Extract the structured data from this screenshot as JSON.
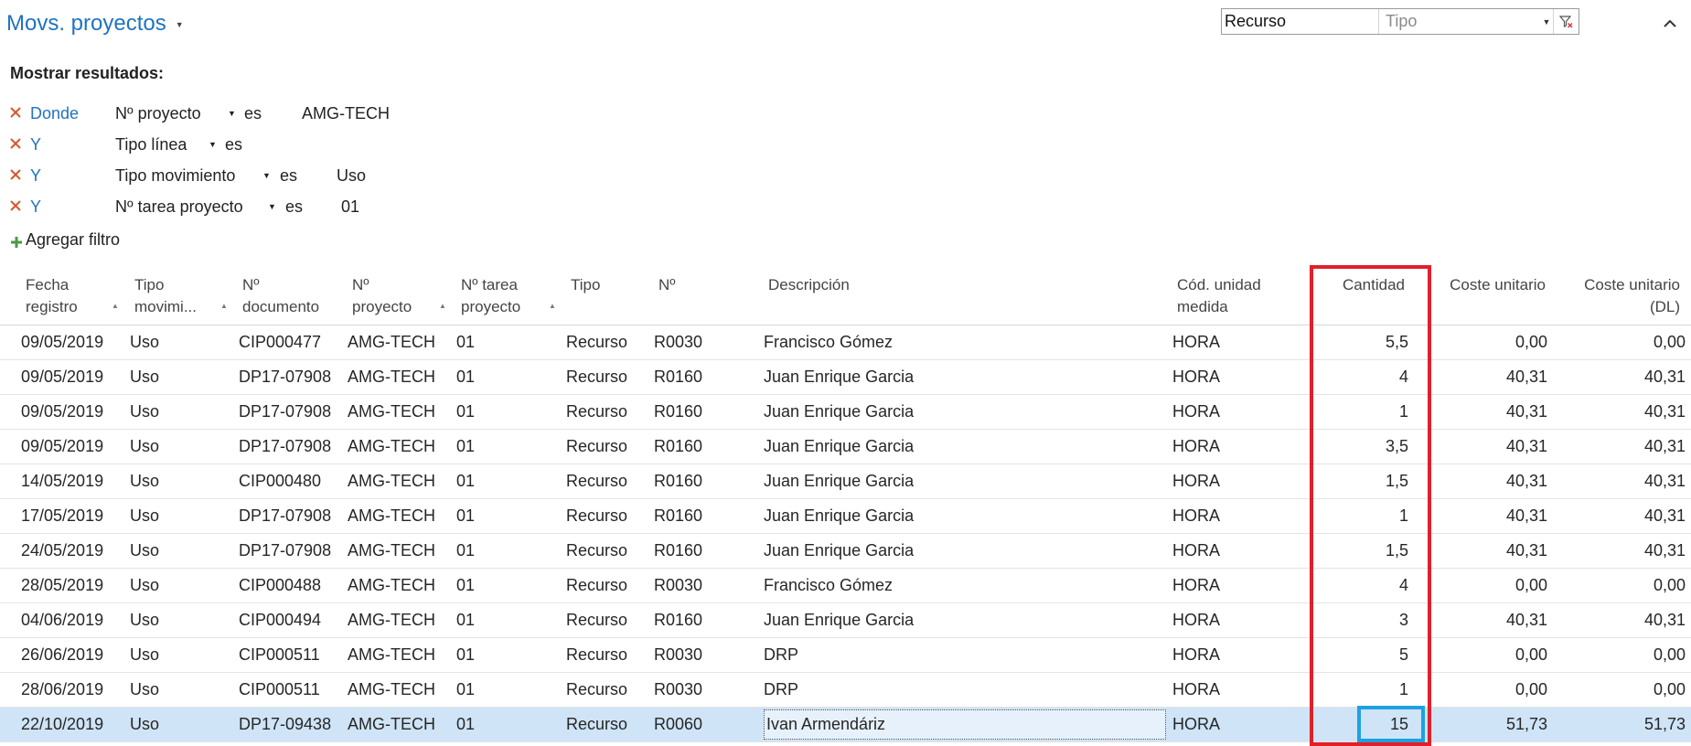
{
  "page": {
    "title": "Movs. proyectos"
  },
  "search": {
    "value": "Recurso",
    "type_placeholder": "Tipo"
  },
  "filters": {
    "label": "Mostrar resultados:",
    "rows": [
      {
        "conj": "Donde",
        "field": "Nº proyecto",
        "op": "es",
        "value": "AMG-TECH"
      },
      {
        "conj": "Y",
        "field": "Tipo línea",
        "op": "es",
        "value": ""
      },
      {
        "conj": "Y",
        "field": "Tipo movimiento",
        "op": "es",
        "value": "Uso"
      },
      {
        "conj": "Y",
        "field": "Nº tarea proyecto",
        "op": "es",
        "value": "01"
      }
    ],
    "add_label": "Agregar filtro"
  },
  "table": {
    "headers": {
      "fecha_1": "Fecha",
      "fecha_2": "registro",
      "tipo_mov_1": "Tipo",
      "tipo_mov_2": "movimi...",
      "ndoc_1": "Nº",
      "ndoc_2": "documento",
      "nproy_1": "Nº",
      "nproy_2": "proyecto",
      "ntarea_1": "Nº tarea",
      "ntarea_2": "proyecto",
      "tipo": "Tipo",
      "n": "Nº",
      "desc": "Descripción",
      "unidad_1": "Cód. unidad",
      "unidad_2": "medida",
      "cantidad": "Cantidad",
      "coste": "Coste unitario",
      "costedl_1": "Coste unitario",
      "costedl_2": "(DL)"
    },
    "rows": [
      {
        "fecha": "09/05/2019",
        "tipo_mov": "Uso",
        "ndoc": "CIP000477",
        "nproy": "AMG-TECH",
        "ntarea": "01",
        "tipo": "Recurso",
        "n": "R0030",
        "desc": "Francisco Gómez",
        "unidad": "HORA",
        "cantidad": "5,5",
        "coste": "0,00",
        "costedl": "0,00"
      },
      {
        "fecha": "09/05/2019",
        "tipo_mov": "Uso",
        "ndoc": "DP17-07908",
        "nproy": "AMG-TECH",
        "ntarea": "01",
        "tipo": "Recurso",
        "n": "R0160",
        "desc": "Juan Enrique Garcia",
        "unidad": "HORA",
        "cantidad": "4",
        "coste": "40,31",
        "costedl": "40,31"
      },
      {
        "fecha": "09/05/2019",
        "tipo_mov": "Uso",
        "ndoc": "DP17-07908",
        "nproy": "AMG-TECH",
        "ntarea": "01",
        "tipo": "Recurso",
        "n": "R0160",
        "desc": "Juan Enrique Garcia",
        "unidad": "HORA",
        "cantidad": "1",
        "coste": "40,31",
        "costedl": "40,31"
      },
      {
        "fecha": "09/05/2019",
        "tipo_mov": "Uso",
        "ndoc": "DP17-07908",
        "nproy": "AMG-TECH",
        "ntarea": "01",
        "tipo": "Recurso",
        "n": "R0160",
        "desc": "Juan Enrique Garcia",
        "unidad": "HORA",
        "cantidad": "3,5",
        "coste": "40,31",
        "costedl": "40,31"
      },
      {
        "fecha": "14/05/2019",
        "tipo_mov": "Uso",
        "ndoc": "CIP000480",
        "nproy": "AMG-TECH",
        "ntarea": "01",
        "tipo": "Recurso",
        "n": "R0160",
        "desc": "Juan Enrique Garcia",
        "unidad": "HORA",
        "cantidad": "1,5",
        "coste": "40,31",
        "costedl": "40,31"
      },
      {
        "fecha": "17/05/2019",
        "tipo_mov": "Uso",
        "ndoc": "DP17-07908",
        "nproy": "AMG-TECH",
        "ntarea": "01",
        "tipo": "Recurso",
        "n": "R0160",
        "desc": "Juan Enrique Garcia",
        "unidad": "HORA",
        "cantidad": "1",
        "coste": "40,31",
        "costedl": "40,31"
      },
      {
        "fecha": "24/05/2019",
        "tipo_mov": "Uso",
        "ndoc": "DP17-07908",
        "nproy": "AMG-TECH",
        "ntarea": "01",
        "tipo": "Recurso",
        "n": "R0160",
        "desc": "Juan Enrique Garcia",
        "unidad": "HORA",
        "cantidad": "1,5",
        "coste": "40,31",
        "costedl": "40,31"
      },
      {
        "fecha": "28/05/2019",
        "tipo_mov": "Uso",
        "ndoc": "CIP000488",
        "nproy": "AMG-TECH",
        "ntarea": "01",
        "tipo": "Recurso",
        "n": "R0030",
        "desc": "Francisco Gómez",
        "unidad": "HORA",
        "cantidad": "4",
        "coste": "0,00",
        "costedl": "0,00"
      },
      {
        "fecha": "04/06/2019",
        "tipo_mov": "Uso",
        "ndoc": "CIP000494",
        "nproy": "AMG-TECH",
        "ntarea": "01",
        "tipo": "Recurso",
        "n": "R0160",
        "desc": "Juan Enrique Garcia",
        "unidad": "HORA",
        "cantidad": "3",
        "coste": "40,31",
        "costedl": "40,31"
      },
      {
        "fecha": "26/06/2019",
        "tipo_mov": "Uso",
        "ndoc": "CIP000511",
        "nproy": "AMG-TECH",
        "ntarea": "01",
        "tipo": "Recurso",
        "n": "R0030",
        "desc": "DRP",
        "unidad": "HORA",
        "cantidad": "5",
        "coste": "0,00",
        "costedl": "0,00"
      },
      {
        "fecha": "28/06/2019",
        "tipo_mov": "Uso",
        "ndoc": "CIP000511",
        "nproy": "AMG-TECH",
        "ntarea": "01",
        "tipo": "Recurso",
        "n": "R0030",
        "desc": "DRP",
        "unidad": "HORA",
        "cantidad": "1",
        "coste": "0,00",
        "costedl": "0,00"
      },
      {
        "fecha": "22/10/2019",
        "tipo_mov": "Uso",
        "ndoc": "DP17-09438",
        "nproy": "AMG-TECH",
        "ntarea": "01",
        "tipo": "Recurso",
        "n": "R0060",
        "desc": "Ivan Armendáriz",
        "unidad": "HORA",
        "cantidad": "15",
        "coste": "51,73",
        "costedl": "51,73",
        "selected": true
      }
    ]
  },
  "colors": {
    "accent": "#1f73c1",
    "selected_row": "#cfe4f7",
    "highlight_red": "#e0202a",
    "highlight_blue": "#1ea1e0"
  }
}
